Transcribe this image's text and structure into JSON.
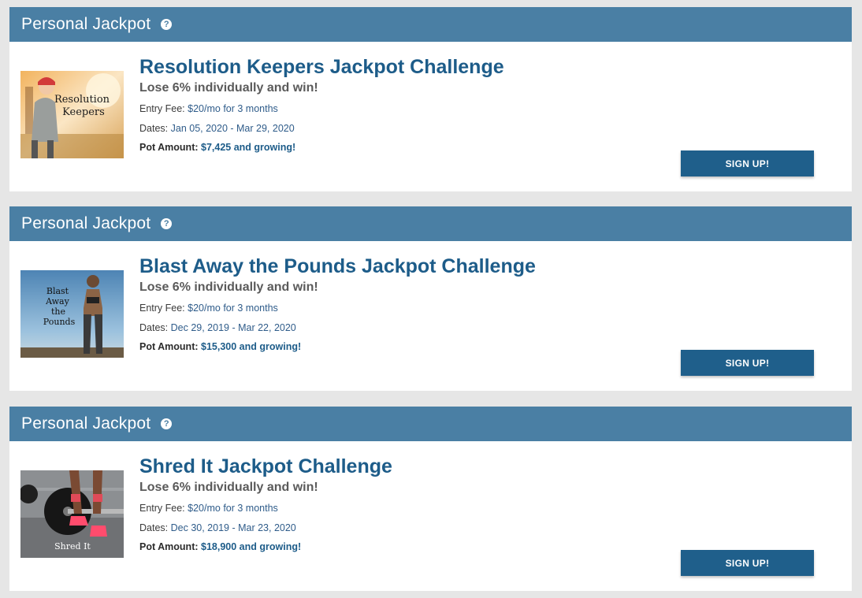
{
  "colors": {
    "header_bg": "#4a7fa4",
    "title": "#1d5c89",
    "button_bg": "#1f5f8b",
    "page_bg": "#e6e6e6"
  },
  "challenges": [
    {
      "header": "Personal Jackpot",
      "help_icon": "question-circle-icon",
      "image_caption": "Resolution Keepers",
      "title": "Resolution Keepers Jackpot Challenge",
      "subtitle": "Lose 6% individually and win!",
      "entry_label": "Entry Fee:",
      "entry_value": "$20/mo for 3 months",
      "dates_label": "Dates:",
      "dates_value": "Jan 05, 2020 - Mar 29, 2020",
      "pot_label": "Pot Amount:",
      "pot_value": "$7,425 and growing!",
      "button": "SIGN UP!"
    },
    {
      "header": "Personal Jackpot",
      "help_icon": "question-circle-icon",
      "image_caption": "Blast Away the Pounds",
      "title": "Blast Away the Pounds Jackpot Challenge",
      "subtitle": "Lose 6% individually and win!",
      "entry_label": "Entry Fee:",
      "entry_value": "$20/mo for 3 months",
      "dates_label": "Dates:",
      "dates_value": "Dec 29, 2019 - Mar 22, 2020",
      "pot_label": "Pot Amount:",
      "pot_value": "$15,300 and growing!",
      "button": "SIGN UP!"
    },
    {
      "header": "Personal Jackpot",
      "help_icon": "question-circle-icon",
      "image_caption": "Shred It",
      "title": "Shred It Jackpot Challenge",
      "subtitle": "Lose 6% individually and win!",
      "entry_label": "Entry Fee:",
      "entry_value": "$20/mo for 3 months",
      "dates_label": "Dates:",
      "dates_value": "Dec 30, 2019 - Mar 23, 2020",
      "pot_label": "Pot Amount:",
      "pot_value": "$18,900 and growing!",
      "button": "SIGN UP!"
    }
  ]
}
